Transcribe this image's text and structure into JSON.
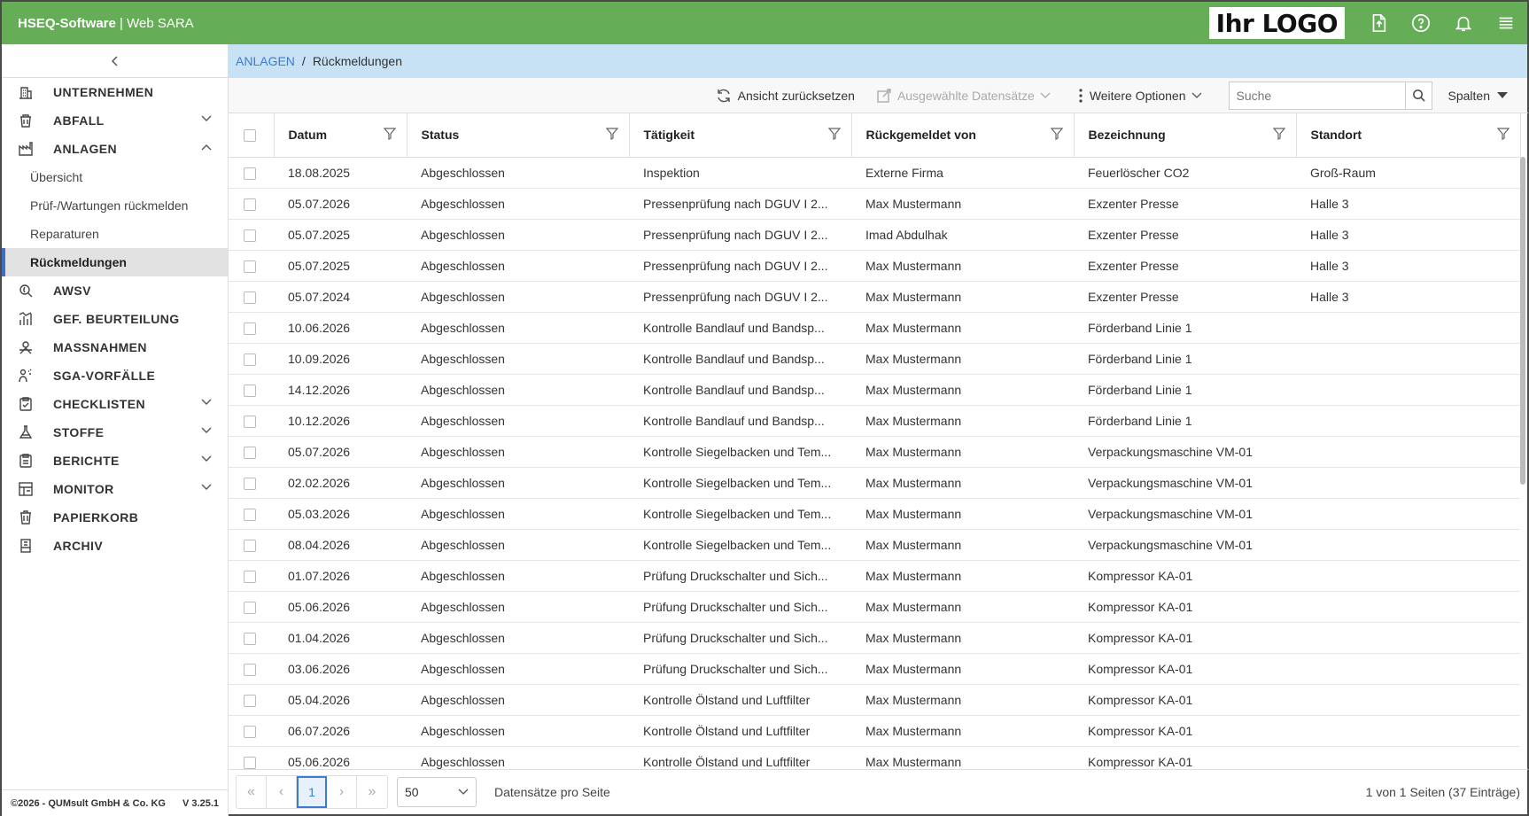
{
  "header": {
    "brand": "HSEQ-Software",
    "separator": " | ",
    "product": "Web SARA",
    "logo_text": "Ihr LOGO"
  },
  "sidebar": {
    "items": [
      {
        "label": "UNTERNEHMEN",
        "icon": "building-icon",
        "chevron": ""
      },
      {
        "label": "ABFALL",
        "icon": "waste-bin-icon",
        "chevron": "down"
      },
      {
        "label": "ANLAGEN",
        "icon": "factory-icon",
        "chevron": "up"
      },
      {
        "label": "AWSV",
        "icon": "water-icon",
        "chevron": ""
      },
      {
        "label": "GEF. BEURTEILUNG",
        "icon": "chart-icon",
        "chevron": ""
      },
      {
        "label": "MASSNAHMEN",
        "icon": "measures-icon",
        "chevron": ""
      },
      {
        "label": "SGA-VORFÄLLE",
        "icon": "incident-icon",
        "chevron": ""
      },
      {
        "label": "CHECKLISTEN",
        "icon": "checklist-icon",
        "chevron": "down"
      },
      {
        "label": "STOFFE",
        "icon": "flask-icon",
        "chevron": "down"
      },
      {
        "label": "BERICHTE",
        "icon": "report-icon",
        "chevron": "down"
      },
      {
        "label": "MONITOR",
        "icon": "monitor-icon",
        "chevron": "down"
      },
      {
        "label": "PAPIERKORB",
        "icon": "trash-icon",
        "chevron": ""
      },
      {
        "label": "ARCHIV",
        "icon": "archive-icon",
        "chevron": ""
      }
    ],
    "sub_items": [
      {
        "label": "Übersicht"
      },
      {
        "label": "Prüf-/Wartungen rückmelden"
      },
      {
        "label": "Reparaturen"
      },
      {
        "label": "Rückmeldungen"
      }
    ],
    "footer_copy": "©2026 - QUMsult GmbH & Co. KG",
    "footer_version": "V 3.25.1"
  },
  "breadcrumb": {
    "parent": "ANLAGEN",
    "sep": "/",
    "current": "Rückmeldungen"
  },
  "toolbar": {
    "reset_label": "Ansicht zurücksetzen",
    "selected_label": "Ausgewählte Datensätze",
    "more_label": "Weitere Optionen",
    "search_placeholder": "Suche",
    "columns_label": "Spalten"
  },
  "table": {
    "columns": [
      "Datum",
      "Status",
      "Tätigkeit",
      "Rückgemeldet von",
      "Bezeichnung",
      "Standort"
    ],
    "rows": [
      [
        "18.08.2025",
        "Abgeschlossen",
        "Inspektion",
        "Externe Firma",
        "Feuerlöscher CO2",
        "Groß-Raum"
      ],
      [
        "05.07.2026",
        "Abgeschlossen",
        "Pressenprüfung nach DGUV I 2...",
        "Max Mustermann",
        "Exzenter Presse",
        "Halle 3"
      ],
      [
        "05.07.2025",
        "Abgeschlossen",
        "Pressenprüfung nach DGUV I 2...",
        "Imad Abdulhak",
        "Exzenter Presse",
        "Halle 3"
      ],
      [
        "05.07.2025",
        "Abgeschlossen",
        "Pressenprüfung nach DGUV I 2...",
        "Max Mustermann",
        "Exzenter Presse",
        "Halle 3"
      ],
      [
        "05.07.2024",
        "Abgeschlossen",
        "Pressenprüfung nach DGUV I 2...",
        "Max Mustermann",
        "Exzenter Presse",
        "Halle 3"
      ],
      [
        "10.06.2026",
        "Abgeschlossen",
        "Kontrolle Bandlauf und Bandsp...",
        "Max Mustermann",
        "Förderband Linie 1",
        ""
      ],
      [
        "10.09.2026",
        "Abgeschlossen",
        "Kontrolle Bandlauf und Bandsp...",
        "Max Mustermann",
        "Förderband Linie 1",
        ""
      ],
      [
        "14.12.2026",
        "Abgeschlossen",
        "Kontrolle Bandlauf und Bandsp...",
        "Max Mustermann",
        "Förderband Linie 1",
        ""
      ],
      [
        "10.12.2026",
        "Abgeschlossen",
        "Kontrolle Bandlauf und Bandsp...",
        "Max Mustermann",
        "Förderband Linie 1",
        ""
      ],
      [
        "05.07.2026",
        "Abgeschlossen",
        "Kontrolle Siegelbacken und Tem...",
        "Max Mustermann",
        "Verpackungsmaschine VM-01",
        ""
      ],
      [
        "02.02.2026",
        "Abgeschlossen",
        "Kontrolle Siegelbacken und Tem...",
        "Max Mustermann",
        "Verpackungsmaschine VM-01",
        ""
      ],
      [
        "05.03.2026",
        "Abgeschlossen",
        "Kontrolle Siegelbacken und Tem...",
        "Max Mustermann",
        "Verpackungsmaschine VM-01",
        ""
      ],
      [
        "08.04.2026",
        "Abgeschlossen",
        "Kontrolle Siegelbacken und Tem...",
        "Max Mustermann",
        "Verpackungsmaschine VM-01",
        ""
      ],
      [
        "01.07.2026",
        "Abgeschlossen",
        "Prüfung Druckschalter und Sich...",
        "Max Mustermann",
        "Kompressor KA-01",
        ""
      ],
      [
        "05.06.2026",
        "Abgeschlossen",
        "Prüfung Druckschalter und Sich...",
        "Max Mustermann",
        "Kompressor KA-01",
        ""
      ],
      [
        "01.04.2026",
        "Abgeschlossen",
        "Prüfung Druckschalter und Sich...",
        "Max Mustermann",
        "Kompressor KA-01",
        ""
      ],
      [
        "03.06.2026",
        "Abgeschlossen",
        "Prüfung Druckschalter und Sich...",
        "Max Mustermann",
        "Kompressor KA-01",
        ""
      ],
      [
        "05.04.2026",
        "Abgeschlossen",
        "Kontrolle Ölstand und Luftfilter",
        "Max Mustermann",
        "Kompressor KA-01",
        ""
      ],
      [
        "06.07.2026",
        "Abgeschlossen",
        "Kontrolle Ölstand und Luftfilter",
        "Max Mustermann",
        "Kompressor KA-01",
        ""
      ],
      [
        "05.06.2026",
        "Abgeschlossen",
        "Kontrolle Ölstand und Luftfilter",
        "Max Mustermann",
        "Kompressor KA-01",
        ""
      ]
    ]
  },
  "pager": {
    "current_page": "1",
    "page_size": "50",
    "page_size_label": "Datensätze pro Seite",
    "info": "1 von 1 Seiten (37 Einträge)"
  },
  "colors": {
    "header_green": "#66ad57",
    "breadcrumb_blue": "#c7e2f5",
    "link_blue": "#3d7bd0"
  }
}
